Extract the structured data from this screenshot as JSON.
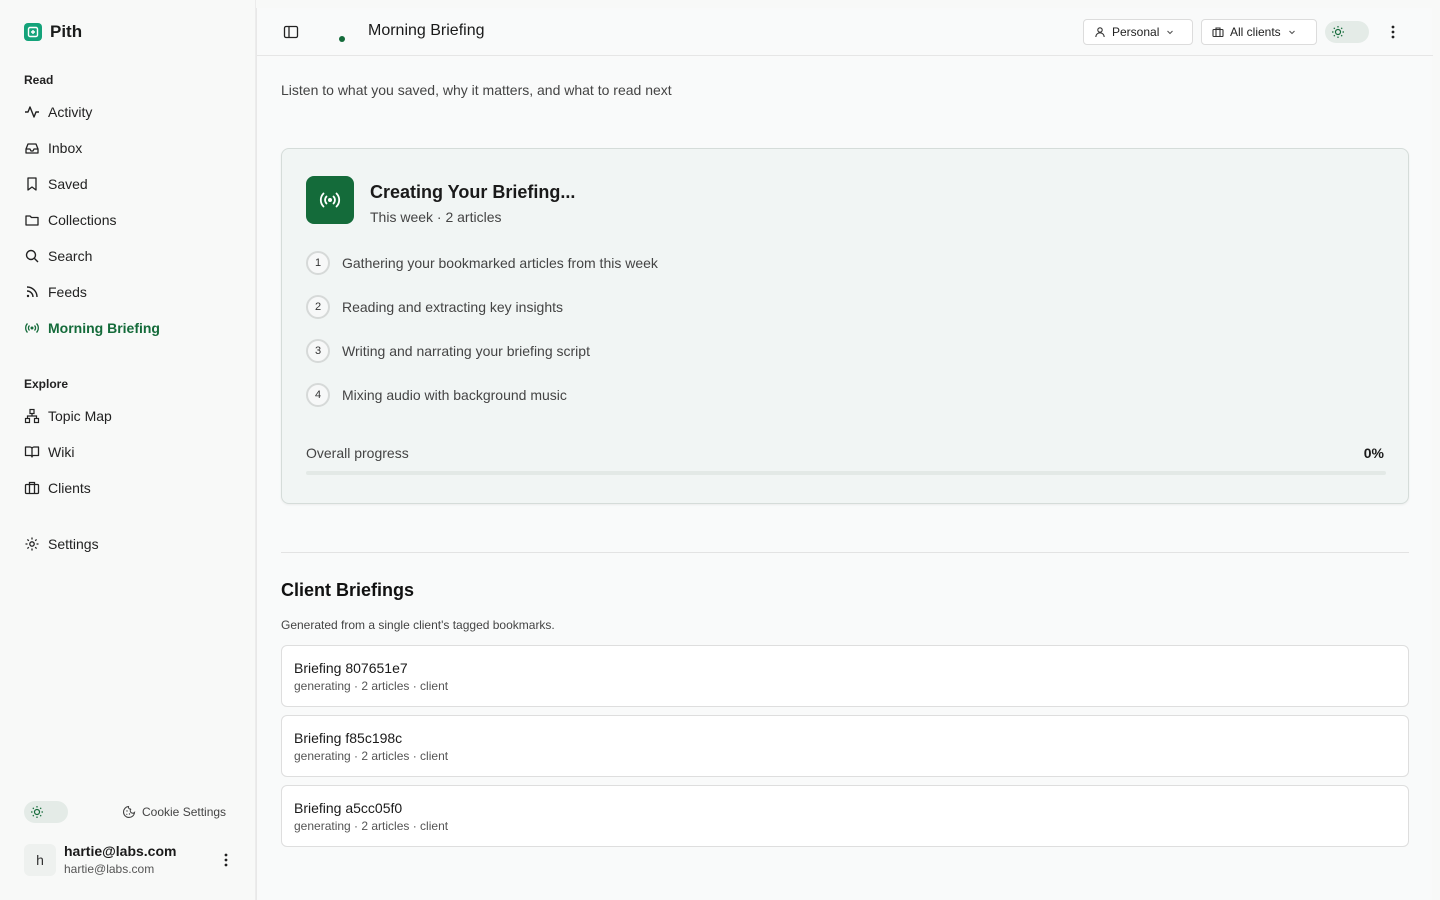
{
  "app": {
    "name": "Pith"
  },
  "sidebar": {
    "sections": {
      "read": "Read",
      "explore": "Explore"
    },
    "read_items": [
      {
        "label": "Activity",
        "icon": "activity-icon"
      },
      {
        "label": "Inbox",
        "icon": "inbox-icon"
      },
      {
        "label": "Saved",
        "icon": "bookmark-icon"
      },
      {
        "label": "Collections",
        "icon": "folder-icon"
      },
      {
        "label": "Search",
        "icon": "search-icon"
      },
      {
        "label": "Feeds",
        "icon": "rss-icon"
      },
      {
        "label": "Morning Briefing",
        "icon": "broadcast-icon",
        "active": true
      }
    ],
    "explore_items": [
      {
        "label": "Topic Map",
        "icon": "network-icon"
      },
      {
        "label": "Wiki",
        "icon": "book-icon"
      },
      {
        "label": "Clients",
        "icon": "briefcase-icon"
      }
    ],
    "settings_label": "Settings",
    "cookie_settings_label": "Cookie Settings",
    "user": {
      "initial": "h",
      "name": "hartie@labs.com",
      "email": "hartie@labs.com"
    }
  },
  "header": {
    "title": "Morning Briefing",
    "personal_label": "Personal",
    "clients_label": "All clients"
  },
  "main": {
    "subtitle": "Listen to what you saved, why it matters, and what to read next",
    "briefing": {
      "title": "Creating Your Briefing...",
      "meta": "This week · 2 articles",
      "steps": [
        {
          "num": "1",
          "label": "Gathering your bookmarked articles from this week"
        },
        {
          "num": "2",
          "label": "Reading and extracting key insights"
        },
        {
          "num": "3",
          "label": "Writing and narrating your briefing script"
        },
        {
          "num": "4",
          "label": "Mixing audio with background music"
        }
      ],
      "progress_label": "Overall progress",
      "progress_value": "0%",
      "progress_fraction": 0
    },
    "client_briefings": {
      "title": "Client Briefings",
      "description": "Generated from a single client's tagged bookmarks.",
      "items": [
        {
          "name": "Briefing 807651e7",
          "meta": "generating · 2 articles · client"
        },
        {
          "name": "Briefing f85c198c",
          "meta": "generating · 2 articles · client"
        },
        {
          "name": "Briefing a5cc05f0",
          "meta": "generating · 2 articles · client"
        }
      ]
    }
  },
  "colors": {
    "accent": "#146b3a",
    "brand": "#14a37a"
  }
}
